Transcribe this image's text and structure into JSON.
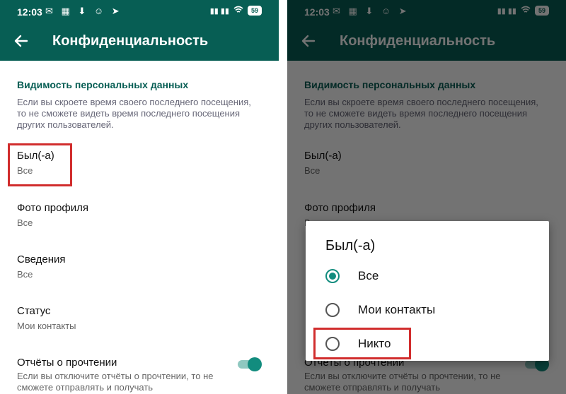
{
  "status_bar": {
    "time": "12:03",
    "left_icons": "✉ ▦ ⬇ ☺ ➤",
    "signal": "▮▮ ▮▮",
    "battery": "59"
  },
  "app_bar": {
    "title": "Конфиденциальность",
    "back_icon": "arrow-left-icon"
  },
  "section": {
    "title": "Видимость персональных данных",
    "description": "Если вы скроете время своего последнего посещения, то не сможете видеть время последнего посещения других пользователей."
  },
  "settings": [
    {
      "title": "Был(-а)",
      "value": "Все"
    },
    {
      "title": "Фото профиля",
      "value": "Все"
    },
    {
      "title": "Сведения",
      "value": "Все"
    },
    {
      "title": "Статус",
      "value": "Мои контакты"
    },
    {
      "title": "Отчёты о прочтении",
      "value": "Если вы отключите отчёты о прочтении, то не сможете отправлять и получать"
    }
  ],
  "dialog": {
    "title": "Был(-а)",
    "options": [
      {
        "label": "Все",
        "selected": true
      },
      {
        "label": "Мои контакты",
        "selected": false
      },
      {
        "label": "Никто",
        "selected": false
      }
    ]
  },
  "colors": {
    "primary": "#075e54",
    "accent": "#128c7e",
    "highlight": "#d12d2d"
  }
}
